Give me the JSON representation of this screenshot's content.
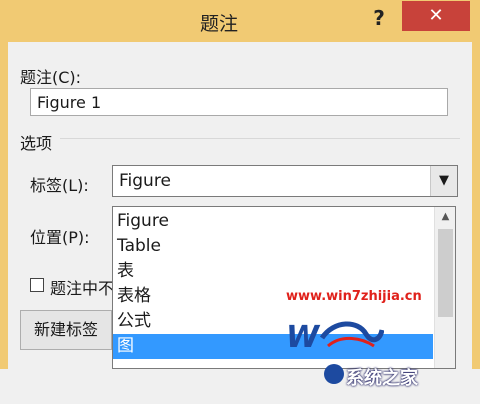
{
  "window": {
    "title": "题注",
    "help": "?",
    "close": "✕"
  },
  "caption": {
    "label": "题注(C):",
    "value": "Figure 1"
  },
  "options": {
    "section": "选项",
    "label_field": "标签(L):",
    "label_value": "Figure",
    "position_field": "位置(P):",
    "exclude_checkbox": "题注中不",
    "new_label_button": "新建标签"
  },
  "dropdown": {
    "items": [
      "Figure",
      "Table",
      "表",
      "表格",
      "公式",
      "图"
    ],
    "selected": "图"
  },
  "watermark": {
    "url": "www.win7zhijia.cn",
    "logo_text": "系统之家"
  }
}
